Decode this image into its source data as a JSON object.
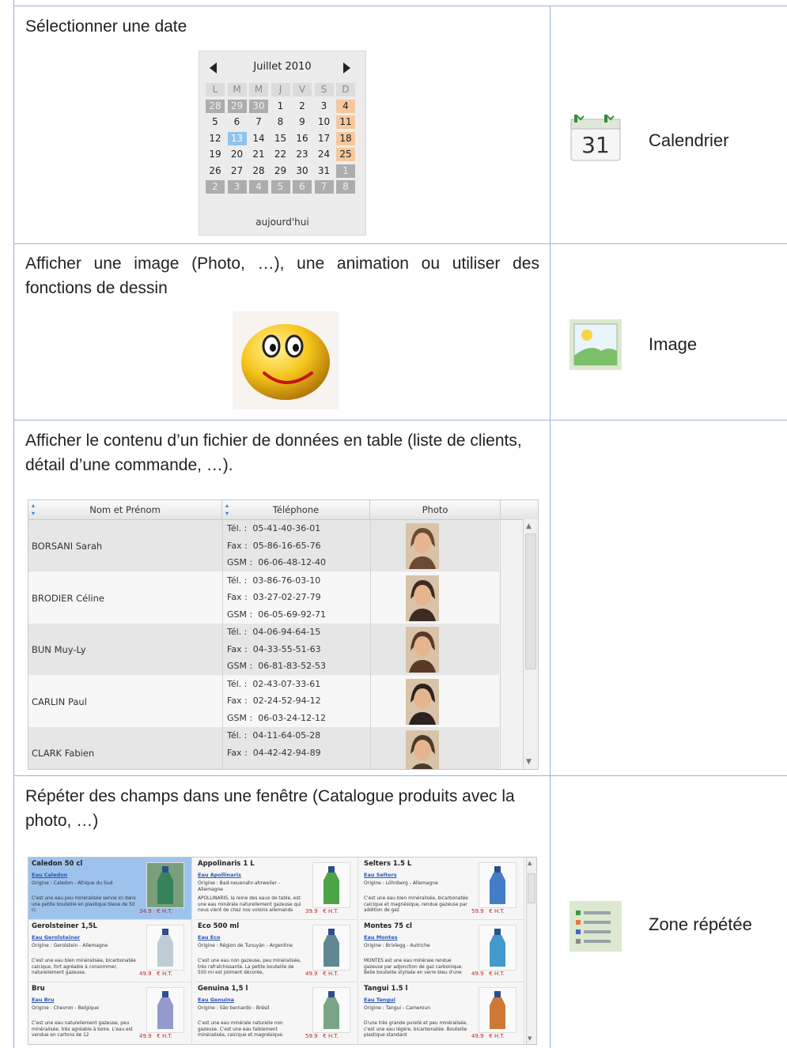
{
  "rows": [
    {
      "description": "Sélectionner une date",
      "control": "Calendrier",
      "icon": "calendar-icon"
    },
    {
      "description": "Afficher une image (Photo, …), une animation ou utiliser des fonctions de dessin",
      "control": "Image",
      "icon": "image-icon"
    },
    {
      "description": "Afficher le contenu d’un fichier de données en table (liste de clients, détail d’une commande, …).",
      "control": "",
      "icon": ""
    },
    {
      "description": "Répéter des champs dans une fenêtre (Catalogue produits avec la photo, …)",
      "control": "Zone répétée",
      "icon": "repeated-zone-icon"
    }
  ],
  "calendar": {
    "month": "Juillet 2010",
    "icon_day": "31",
    "day_headers": [
      "L",
      "M",
      "M",
      "J",
      "V",
      "S",
      "D"
    ],
    "weeks": [
      [
        "28",
        "29",
        "30",
        "1",
        "2",
        "3",
        "4"
      ],
      [
        "5",
        "6",
        "7",
        "8",
        "9",
        "10",
        "11"
      ],
      [
        "12",
        "13",
        "14",
        "15",
        "16",
        "17",
        "18"
      ],
      [
        "19",
        "20",
        "21",
        "22",
        "23",
        "24",
        "25"
      ],
      [
        "26",
        "27",
        "28",
        "29",
        "30",
        "31",
        "1"
      ],
      [
        "2",
        "3",
        "4",
        "5",
        "6",
        "7",
        "8"
      ]
    ],
    "selected_day": "13",
    "today_label": "aujourd'hui",
    "colors": {
      "weekend": "#f7c79c",
      "selected": "#8ec4ec",
      "other_month": "#adadad"
    }
  },
  "table": {
    "columns": [
      "Nom et Prénom",
      "Téléphone",
      "Photo"
    ],
    "rows": [
      {
        "name": "BORSANI Sarah",
        "phones": [
          "Tél. :  05-41-40-36-01",
          "Fax :  05-86-16-65-76",
          "GSM :  06-06-48-12-40"
        ]
      },
      {
        "name": "BRODIER Céline",
        "phones": [
          "Tél. :  03-86-76-03-10",
          "Fax :  03-27-02-27-79",
          "GSM :  06-05-69-92-71"
        ]
      },
      {
        "name": "BUN Muy-Ly",
        "phones": [
          "Tél. :  04-06-94-64-15",
          "Fax :  04-33-55-51-63",
          "GSM :  06-81-83-52-53"
        ]
      },
      {
        "name": "CARLIN Paul",
        "phones": [
          "Tél. :  02-43-07-33-61",
          "Fax :  02-24-52-94-12",
          "GSM :  06-03-24-12-12"
        ]
      },
      {
        "name": "CLARK Fabien",
        "phones": [
          "Tél. :  04-11-64-05-28",
          "Fax :  04-42-42-94-89"
        ]
      }
    ]
  },
  "catalog": [
    {
      "name": "Caledon 50 cl",
      "brand": "Eau Caledon",
      "origin": "Origine : Caledon - Afrique du Sud",
      "description": "C'est une eau peu minéralisée servie ici dans une petite bouteille en plastique bleue de 50 cl.",
      "price": "34.9   € H.T.",
      "color": "#2f7f56"
    },
    {
      "name": "Appolinaris 1 L",
      "brand": "Eau Apollinaris",
      "origin": "Origine : Bad-neuenahr-ahrweiler - Allemagne",
      "description": "APOLLINARIS, la reine des eaux de table, est une eau minérale naturellement gazeuse qui nous vient de chez nos voisins allemands",
      "price": "39.9   € H.T.",
      "color": "#3a9a30"
    },
    {
      "name": "Selters 1.5 L",
      "brand": "Eau Selters",
      "origin": "Origine : Löhnberg - Allemagne",
      "description": "C'est une eau bien minéralisée, bicarbonatée calcique et magnésique, rendue gazeuse par addition de gaz",
      "price": "59.9   € H.T.",
      "color": "#2f6fc0"
    },
    {
      "name": "Gerolsteiner 1,5L",
      "brand": "Eau Gerolsteiner",
      "origin": "Origine : Gerolstein - Allemagne",
      "description": "C'est une eau bien minéralisée, bicarbonatée calcique, fort agréable à consommer, naturellement gazeuse.",
      "price": "49.9   € H.T.",
      "color": "#b9c6d0"
    },
    {
      "name": "Eco 500 ml",
      "brand": "Eau Eco",
      "origin": "Origine : Région de Tunuyán - Argentine",
      "description": "C'est une eau non gazeuse, peu minéralisée, très rafraîchissante. La petite bouteille de 500 ml est joliment décorée,",
      "price": "49.9   € H.T.",
      "color": "#4f7a86"
    },
    {
      "name": "Montes 75 cl",
      "brand": "Eau Montes",
      "origin": "Origine : Brixlegg - Autriche",
      "description": "MONTES est une eau minérale rendue gazeuse par adjonction de gaz carbonique. Belle bouteille stylisée en verre bleu d'une",
      "price": "49.9   € H.T.",
      "color": "#2e8ec8"
    },
    {
      "name": "Bru",
      "brand": "Eau Bru",
      "origin": "Origine : Chevron - Belgique",
      "description": "C'est une eau naturellement gazeuse, peu minéralisée, très agréable à boire. L'eau est vendue en cartons de 12",
      "price": "49.9   € H.T.",
      "color": "#8a8fc8"
    },
    {
      "name": "Genuina 1,5 l",
      "brand": "Eau Genuina",
      "origin": "Origine : São bernardo - Brésil",
      "description": "C'est une eau minérale naturelle non gazeuse. C'est une eau faiblement minéralisée, calcique et magnésique.",
      "price": "59.9   € H.T.",
      "color": "#6a9a78"
    },
    {
      "name": "Tangui 1.5 l",
      "brand": "Eau Tangui",
      "origin": "Origine : Tangui - Cameroun",
      "description": "D'une très grande pureté et peu minéralisée, c'est une eau légère, bicarbonatée. Bouteille plastique standard",
      "price": "49.9   € H.T.",
      "color": "#c86a1f"
    }
  ]
}
